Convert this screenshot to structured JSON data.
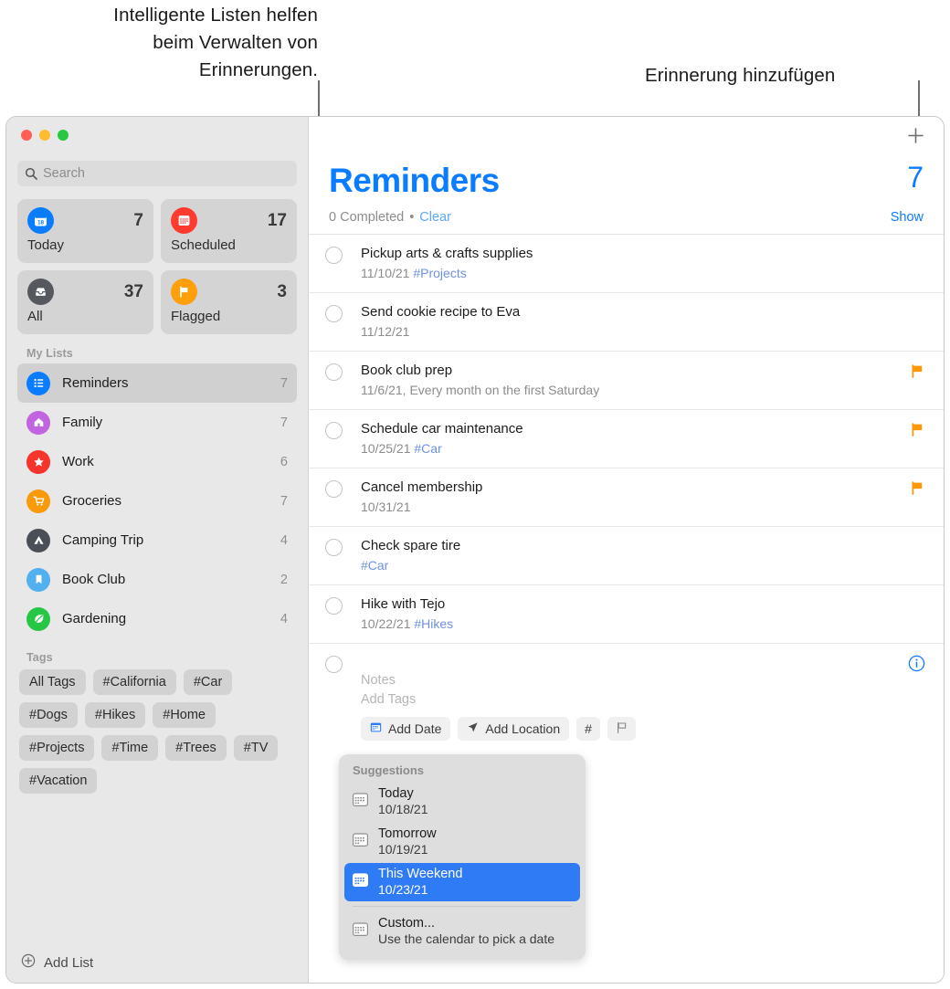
{
  "annotations": {
    "left": "Intelligente Listen helfen beim Verwalten von Erinnerungen.",
    "right": "Erinnerung hinzufügen"
  },
  "colors": {
    "accent_blue": "#0a7cff",
    "selected_blue": "#2f7bf6",
    "flag_orange": "#ff9500",
    "tag_blue": "#6f91e0",
    "sidebar_bg": "#e8e8e8",
    "traffic_red": "#ff5f57",
    "traffic_yellow": "#febc2e",
    "traffic_green": "#28c840"
  },
  "sidebar": {
    "search": {
      "placeholder": "Search",
      "value": "",
      "icon": "search-icon"
    },
    "smart_lists": [
      {
        "label": "Today",
        "count": "7",
        "icon": "calendar-day-icon",
        "icon_color": "#0a7cff",
        "icon_text": "18"
      },
      {
        "label": "Scheduled",
        "count": "17",
        "icon": "calendar-icon",
        "icon_color": "#ff3b30"
      },
      {
        "label": "All",
        "count": "37",
        "icon": "tray-icon",
        "icon_color": "#55595e"
      },
      {
        "label": "Flagged",
        "count": "3",
        "icon": "flag-icon",
        "icon_color": "#ff9f0a"
      }
    ],
    "my_lists_header": "My Lists",
    "lists": [
      {
        "label": "Reminders",
        "count": "7",
        "icon": "bullet-list-icon",
        "icon_color": "#0a7cff",
        "selected": true
      },
      {
        "label": "Family",
        "count": "7",
        "icon": "house-icon",
        "icon_color": "#c264e0",
        "selected": false
      },
      {
        "label": "Work",
        "count": "6",
        "icon": "star-icon",
        "icon_color": "#f5342b",
        "selected": false
      },
      {
        "label": "Groceries",
        "count": "7",
        "icon": "cart-icon",
        "icon_color": "#f99a0b",
        "selected": false
      },
      {
        "label": "Camping Trip",
        "count": "4",
        "icon": "tent-icon",
        "icon_color": "#4a4f57",
        "selected": false
      },
      {
        "label": "Book Club",
        "count": "2",
        "icon": "bookmark-icon",
        "icon_color": "#52b0ef",
        "selected": false
      },
      {
        "label": "Gardening",
        "count": "4",
        "icon": "leaf-icon",
        "icon_color": "#27c746",
        "selected": false
      }
    ],
    "tags_header": "Tags",
    "tags": [
      "All Tags",
      "#California",
      "#Car",
      "#Dogs",
      "#Hikes",
      "#Home",
      "#Projects",
      "#Time",
      "#Trees",
      "#TV",
      "#Vacation"
    ],
    "add_list_label": "Add List",
    "add_list_icon": "plus-circle-icon"
  },
  "main": {
    "add_reminder_icon": "plus-icon",
    "title": "Reminders",
    "count": "7",
    "completed_text": "0 Completed",
    "separator": "•",
    "clear_label": "Clear",
    "show_label": "Show",
    "reminders": [
      {
        "title": "Pickup arts & crafts supplies",
        "date": "11/10/21",
        "tag": "#Projects",
        "flagged": false
      },
      {
        "title": "Send cookie recipe to Eva",
        "date": "11/12/21",
        "tag": "",
        "flagged": false
      },
      {
        "title": "Book club prep",
        "date": "11/6/21, Every month on the first Saturday",
        "tag": "",
        "flagged": true
      },
      {
        "title": "Schedule car maintenance",
        "date": "10/25/21",
        "tag": "#Car",
        "flagged": true
      },
      {
        "title": "Cancel membership",
        "date": "10/31/21",
        "tag": "",
        "flagged": true
      },
      {
        "title": "Check spare tire",
        "date": "",
        "tag": "#Car",
        "flagged": false
      },
      {
        "title": "Hike with Tejo",
        "date": "10/22/21",
        "tag": "#Hikes",
        "flagged": false
      }
    ],
    "new_reminder": {
      "title_value": "",
      "notes_placeholder": "Notes",
      "tags_placeholder": "Add Tags",
      "info_icon": "info-circle-icon",
      "chips": [
        {
          "label": "Add Date",
          "icon": "calendar-icon"
        },
        {
          "label": "Add Location",
          "icon": "location-arrow-icon"
        },
        {
          "label": "#",
          "icon": "hashtag-icon"
        },
        {
          "label": "",
          "icon": "flag-outline-icon"
        }
      ]
    },
    "suggestions": {
      "header": "Suggestions",
      "items": [
        {
          "label": "Today",
          "sub": "10/18/21",
          "icon": "calendar-icon",
          "selected": false
        },
        {
          "label": "Tomorrow",
          "sub": "10/19/21",
          "icon": "calendar-icon",
          "selected": false
        },
        {
          "label": "This Weekend",
          "sub": "10/23/21",
          "icon": "calendar-icon",
          "selected": true
        },
        {
          "label": "Custom...",
          "sub": "Use the calendar to pick a date",
          "icon": "calendar-icon",
          "selected": false
        }
      ]
    }
  }
}
